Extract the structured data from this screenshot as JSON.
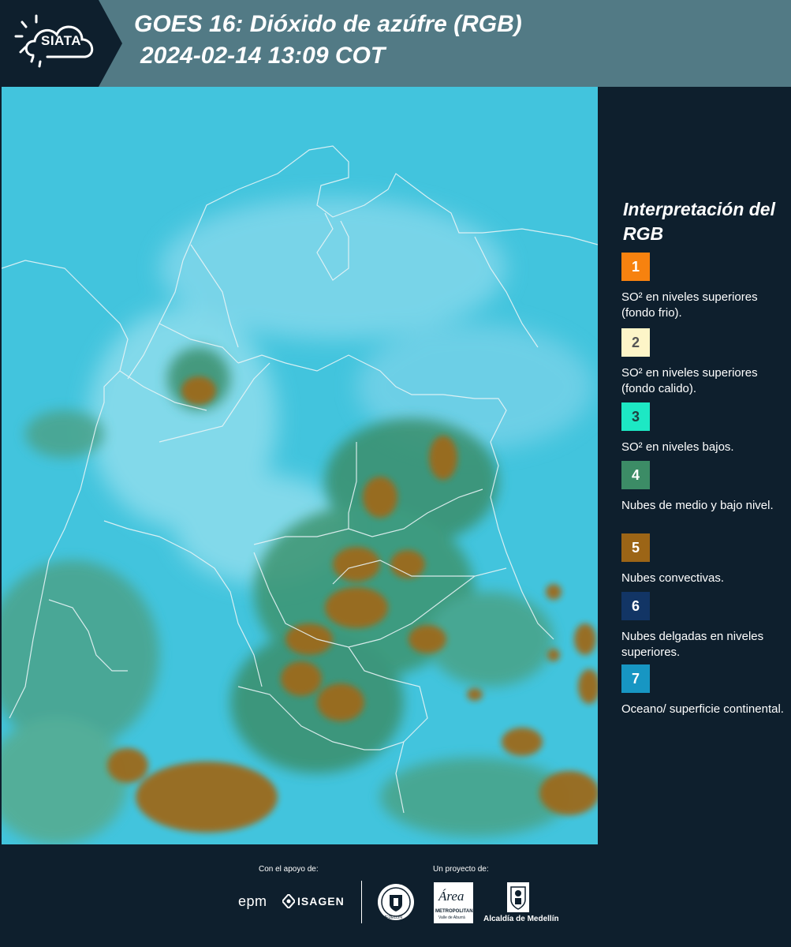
{
  "header": {
    "logo_text": "SIATA",
    "title_line1": "GOES 16: Dióxido de azúfre (RGB)",
    "title_line2": "2024-02-14 13:09 COT"
  },
  "legend": {
    "title": "Interpretación del RGB",
    "items": [
      {
        "number": "1",
        "label": "SO² en niveles superiores (fondo frio).",
        "color": "#f7820f",
        "text_color": "#ffffff"
      },
      {
        "number": "2",
        "label": "SO² en niveles superiores (fondo calido).",
        "color": "#fdf5c8",
        "text_color": "#555555"
      },
      {
        "number": "3",
        "label": "SO² en niveles bajos.",
        "color": "#1de8c4",
        "text_color": "#1e4040"
      },
      {
        "number": "4",
        "label": "Nubes de medio y bajo nivel.",
        "color": "#3c8c66",
        "text_color": "#ffffff"
      },
      {
        "number": "5",
        "label": "Nubes convectivas.",
        "color": "#9c6516",
        "text_color": "#ffffff"
      },
      {
        "number": "6",
        "label": "Nubes delgadas en niveles superiores.",
        "color": "#123565",
        "text_color": "#ffffff"
      },
      {
        "number": "7",
        "label": "Oceano/ superficie continental.",
        "color": "#1796c3",
        "text_color": "#ffffff"
      }
    ]
  },
  "footer": {
    "support_label": "Con el apoyo de:",
    "project_label": "Un proyecto de:",
    "sponsor_epm": "epm",
    "sponsor_isagen": "ISAGEN",
    "area_logo_text": "Área",
    "area_subtext": "METROPOLITANA",
    "area_subtext2": "Valle de Aburrá",
    "medellin_seal_text": "MEDELLÍN",
    "alcaldia": "Alcaldía de Medellín"
  }
}
